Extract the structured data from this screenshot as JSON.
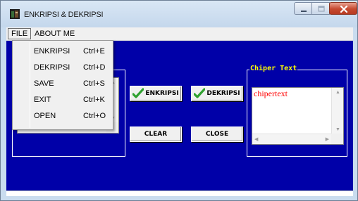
{
  "window": {
    "title": "ENKRIPSI & DEKRIPSI",
    "controls": [
      "minimize-icon",
      "maximize-icon",
      "close-icon"
    ]
  },
  "menubar": {
    "items": [
      {
        "label": "FILE"
      },
      {
        "label": "ABOUT ME"
      }
    ]
  },
  "file_menu": {
    "items": [
      {
        "label": "ENKRIPSI",
        "shortcut": "Ctrl+E"
      },
      {
        "label": "DEKRIPSI",
        "shortcut": "Ctrl+D"
      },
      {
        "label": "SAVE",
        "shortcut": "Ctrl+S"
      },
      {
        "label": "EXIT",
        "shortcut": "Ctrl+K"
      },
      {
        "label": "OPEN",
        "shortcut": "Ctrl+O"
      }
    ]
  },
  "buttons": {
    "enkripsi": "ENKRIPSI",
    "dekripsi": "DEKRIPSI",
    "clear": "CLEAR",
    "close": "CLOSE"
  },
  "cipher_group": {
    "caption": "Chiper Text",
    "value": "chipertext"
  },
  "colors": {
    "client_background": "#0000a8",
    "group_caption": "#ffff00",
    "text_value": "#ff0000",
    "check_icon": "#2fa12f"
  }
}
